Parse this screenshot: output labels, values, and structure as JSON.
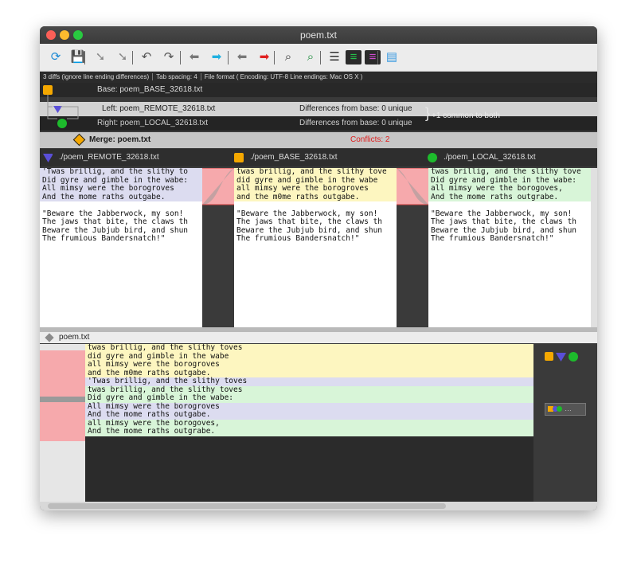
{
  "window": {
    "title": "poem.txt"
  },
  "toolbar": {
    "buttons": [
      {
        "icon": "refresh-icon",
        "glyph": "⟳",
        "color": "#1e8bd6"
      },
      {
        "icon": "save-icon",
        "glyph": "💾",
        "color": "#1e6fd6"
      },
      {
        "icon": "take-left-icon",
        "glyph": "➘",
        "color": "#888"
      },
      {
        "icon": "take-right-icon",
        "glyph": "➘",
        "color": "#888"
      },
      {
        "icon": "undo-icon",
        "glyph": "↶",
        "color": "#555"
      },
      {
        "icon": "redo-icon",
        "glyph": "↷",
        "color": "#555"
      },
      {
        "icon": "prev-diff-icon",
        "glyph": "⬅",
        "color": "#777"
      },
      {
        "icon": "next-diff-icon",
        "glyph": "➡",
        "color": "#1fb0e0"
      },
      {
        "icon": "prev-conflict-icon",
        "glyph": "⬅",
        "color": "#777"
      },
      {
        "icon": "next-conflict-icon",
        "glyph": "➡",
        "color": "#e02020"
      },
      {
        "icon": "find-icon",
        "glyph": "⌕",
        "color": "#333"
      },
      {
        "icon": "find-next-icon",
        "glyph": "⌕",
        "color": "#1a8a3a"
      },
      {
        "icon": "line-numbers-icon",
        "glyph": "☰",
        "color": "#333"
      },
      {
        "icon": "show-changes-icon",
        "glyph": "≡",
        "color": "#24c24a"
      },
      {
        "icon": "show-all-icon",
        "glyph": "≡",
        "color": "#d04ad0"
      },
      {
        "icon": "layout-icon",
        "glyph": "▤",
        "color": "#3a9ae0"
      }
    ]
  },
  "status": {
    "diffs": "3 diffs (ignore line ending differences)",
    "tab_spacing": "Tab spacing: 4",
    "file_format": "File format ( Encoding: UTF-8  Line endings: Mac OS X )"
  },
  "files": {
    "base_label": "Base: poem_BASE_32618.txt",
    "left_label": "Left: poem_REMOTE_32618.txt",
    "left_diff": "Differences from base: 0 unique",
    "right_label": "Right: poem_LOCAL_32618.txt",
    "right_diff": "Differences from base: 0 unique",
    "common_note": "+1 common to both",
    "merge_label": "Merge: poem.txt",
    "conflicts": "Conflicts: 2"
  },
  "panes": {
    "remote": {
      "title": "./poem_REMOTE_32618.txt"
    },
    "base": {
      "title": "./poem_BASE_32618.txt"
    },
    "local": {
      "title": "./poem_LOCAL_32618.txt"
    }
  },
  "remote_lines": [
    {
      "text": "'Twas brillig, and the slithy to",
      "bg": "#dcdcf0"
    },
    {
      "text": "Did gyre and gimble in the wabe:",
      "bg": "#dcdcf0"
    },
    {
      "text": "All mimsy were the borogroves",
      "bg": "#dcdcf0"
    },
    {
      "text": "And the mome raths outgabe.",
      "bg": "#dcdcf0"
    },
    {
      "text": "",
      "bg": "#ffffff"
    },
    {
      "text": "\"Beware the Jabberwock, my son!",
      "bg": "#ffffff"
    },
    {
      "text": "The jaws that bite, the claws th",
      "bg": "#ffffff"
    },
    {
      "text": "Beware the Jubjub bird, and shun",
      "bg": "#ffffff"
    },
    {
      "text": "The frumious Bandersnatch!\"",
      "bg": "#ffffff"
    }
  ],
  "base_lines": [
    {
      "text": "twas brillig, and the slithy tove",
      "bg": "#fdf6c0"
    },
    {
      "text": "did gyre and gimble in the wabe",
      "bg": "#fdf6c0"
    },
    {
      "text": "all mimsy were the borogroves",
      "bg": "#fdf6c0"
    },
    {
      "text": "and the m0me raths outgabe.",
      "bg": "#fdf6c0"
    },
    {
      "text": "",
      "bg": "#ffffff"
    },
    {
      "text": "\"Beware the Jabberwock, my son!",
      "bg": "#ffffff"
    },
    {
      "text": "The jaws that bite, the claws th",
      "bg": "#ffffff"
    },
    {
      "text": "Beware the Jubjub bird, and shun",
      "bg": "#ffffff"
    },
    {
      "text": "The frumious Bandersnatch!\"",
      "bg": "#ffffff"
    }
  ],
  "local_lines": [
    {
      "text": "twas brillig, and the slithy tove",
      "bg": "#d8f5d8"
    },
    {
      "text": "Did gyre and gimble in the wabe:",
      "bg": "#d8f5d8"
    },
    {
      "text": "all mimsy were the borogoves,",
      "bg": "#d8f5d8"
    },
    {
      "text": "And the mome raths outgrabe.",
      "bg": "#d8f5d8"
    },
    {
      "text": "",
      "bg": "#ffffff"
    },
    {
      "text": "\"Beware the Jabberwock, my son!",
      "bg": "#ffffff"
    },
    {
      "text": "The jaws that bite, the claws th",
      "bg": "#ffffff"
    },
    {
      "text": "Beware the Jubjub bird, and shun",
      "bg": "#ffffff"
    },
    {
      "text": "The frumious Bandersnatch!\"",
      "bg": "#ffffff"
    }
  ],
  "merge": {
    "title": "poem.txt"
  },
  "merge_lines": [
    {
      "text": "twas brillig, and the slithy toves",
      "bg": "#fdf6c0"
    },
    {
      "text": "did gyre and gimble in the wabe",
      "bg": "#fdf6c0"
    },
    {
      "text": "all mimsy were the borogroves",
      "bg": "#fdf6c0"
    },
    {
      "text": "and the m0me raths outgabe.",
      "bg": "#fdf6c0"
    },
    {
      "text": "'Twas brillig, and the slithy toves",
      "bg": "#dcdcf0"
    },
    {
      "text": "twas brillig, and the slithy toves",
      "bg": "#d8f5d8"
    },
    {
      "text": "Did gyre and gimble in the wabe:",
      "bg": "#d8f5d8"
    },
    {
      "text": "All mimsy were the borogroves",
      "bg": "#dcdcf0"
    },
    {
      "text": "And the mome raths outgabe.",
      "bg": "#dcdcf0"
    },
    {
      "text": "all mimsy were the borogoves,",
      "bg": "#d8f5d8"
    },
    {
      "text": "And the mome raths outgrabe.",
      "bg": "#d8f5d8"
    }
  ],
  "colors": {
    "conflict_red": "#f6a9ac",
    "remote_blue": "#dcdcf0",
    "base_yellow": "#fdf6c0",
    "local_green": "#d8f5d8",
    "accent_orange": "#f5a800",
    "accent_blue": "#5a4fd8",
    "accent_green": "#1dbb2c"
  }
}
